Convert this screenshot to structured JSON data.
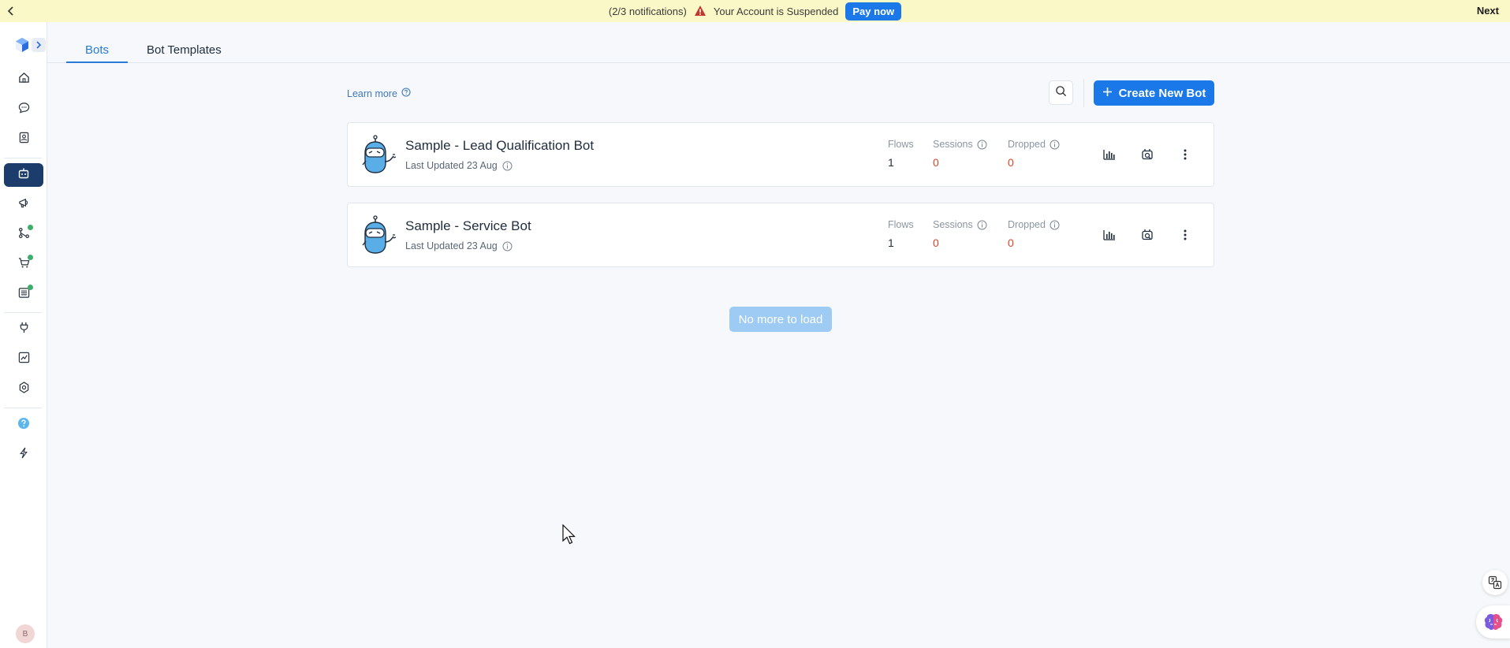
{
  "notification_bar": {
    "counter": "(2/3 notifications)",
    "message": "Your Account is Suspended",
    "pay_label": "Pay now",
    "next_label": "Next"
  },
  "sidebar": {
    "items": [
      {
        "icon": "home-icon"
      },
      {
        "icon": "chat-icon"
      },
      {
        "icon": "contacts-icon"
      },
      {
        "icon": "bot-icon",
        "active": true
      },
      {
        "icon": "megaphone-icon"
      },
      {
        "icon": "flow-icon",
        "dot": true
      },
      {
        "icon": "cart-icon",
        "dot": true
      },
      {
        "icon": "list-icon",
        "dot": true
      },
      {
        "icon": "plug-icon"
      },
      {
        "icon": "analytics-icon"
      },
      {
        "icon": "settings-icon"
      },
      {
        "icon": "help-icon"
      },
      {
        "icon": "bolt-icon"
      }
    ],
    "avatar_initial": "B"
  },
  "tabs": [
    {
      "label": "Bots",
      "active": true
    },
    {
      "label": "Bot Templates",
      "active": false
    }
  ],
  "toolbar": {
    "learn_more": "Learn more",
    "create_label": "Create New Bot"
  },
  "stat_labels": {
    "flows": "Flows",
    "sessions": "Sessions",
    "dropped": "Dropped"
  },
  "bots": [
    {
      "name": "Sample - Lead Qualification Bot",
      "updated": "Last Updated 23 Aug",
      "flows": "1",
      "sessions": "0",
      "dropped": "0"
    },
    {
      "name": "Sample - Service Bot",
      "updated": "Last Updated 23 Aug",
      "flows": "1",
      "sessions": "0",
      "dropped": "0"
    }
  ],
  "no_more_label": "No more to load",
  "colors": {
    "accent": "#1a78e8",
    "sidebar_active": "#1c3d6b",
    "notification_bg": "#fbf8c8",
    "alert_red": "#d9452b"
  }
}
